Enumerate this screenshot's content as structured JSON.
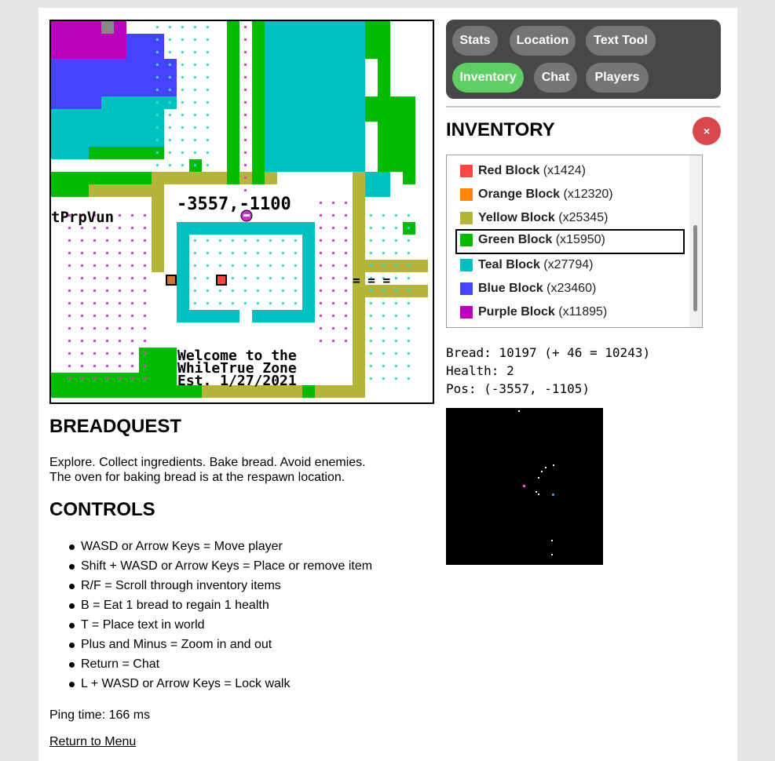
{
  "game": {
    "title": "BREADQUEST",
    "description_line1": "Explore. Collect ingredients. Bake bread. Avoid enemies.",
    "description_line2": "The oven for baking bread is at the respawn location.",
    "world_text": {
      "coords": "-3557,-1100",
      "side_label": "tPrpVun",
      "welcome_line1": "Welcome to the",
      "welcome_line2": "WhileTrue Zone",
      "welcome_line3": "Est. 1/27/2021",
      "sign": "= = ="
    }
  },
  "controls": {
    "heading": "CONTROLS",
    "items": [
      "WASD or Arrow Keys = Move player",
      "Shift + WASD or Arrow Keys = Place or remove item",
      "R/F = Scroll through inventory items",
      "B = Eat 1 bread to regain 1 health",
      "T = Place text in world",
      "Plus and Minus = Zoom in and out",
      "Return = Chat",
      "L + WASD or Arrow Keys = Lock walk"
    ]
  },
  "ping": "Ping time: 166 ms",
  "menu_link": "Return to Menu",
  "tabs": [
    {
      "label": "Stats",
      "active": false
    },
    {
      "label": "Location",
      "active": false
    },
    {
      "label": "Text Tool",
      "active": false
    },
    {
      "label": "Inventory",
      "active": true
    },
    {
      "label": "Chat",
      "active": false
    },
    {
      "label": "Players",
      "active": false
    }
  ],
  "inventory": {
    "title": "INVENTORY",
    "close_label": "×",
    "selected_index": 2,
    "items": [
      {
        "name": "Red Block",
        "count": "(x1424)",
        "color": "#ff4444"
      },
      {
        "name": "Orange Block",
        "count": "(x12320)",
        "color": "#ff8800"
      },
      {
        "name": "Yellow Block",
        "count": "(x25345)",
        "color": "#b5b53c"
      },
      {
        "name": "Green Block",
        "count": "(x15950)",
        "color": "#00bb00"
      },
      {
        "name": "Teal Block",
        "count": "(x27794)",
        "color": "#00c0c0"
      },
      {
        "name": "Blue Block",
        "count": "(x23460)",
        "color": "#4444ff"
      },
      {
        "name": "Purple Block",
        "count": "(x11895)",
        "color": "#bb00bb"
      }
    ]
  },
  "stats": {
    "bread": "Bread: 10197 (+ 46 = 10243)",
    "health": "Health: 2",
    "pos": "Pos: (-3557, -1105)"
  },
  "colors": {
    "magenta": "#bb00bb",
    "blue": "#4444ff",
    "teal": "#00c0c0",
    "green": "#00bb00",
    "olive": "#b5b53c",
    "pink_dot": "#ff33cc",
    "teal_dot": "#33dddd",
    "tab_active": "#5fce64",
    "tab_inactive": "#757575",
    "close": "#d9484e"
  }
}
